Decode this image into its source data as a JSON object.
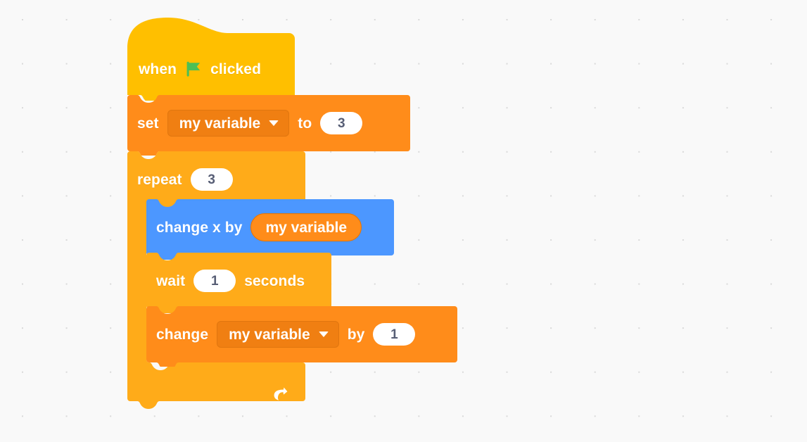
{
  "app": {
    "name": "Scratch Block Editor",
    "canvas_background": "#f9f9f9",
    "dot_color": "#d9d9d9"
  },
  "palette": {
    "events_yellow": "#ffbf00",
    "events_yellow_dark": "#e8a900",
    "variables_orange": "#ff8c1a",
    "variables_orange_dark": "#e77300",
    "variables_field": "#f07f12",
    "control_orange": "#ffab19",
    "control_orange_dark": "#e8950f",
    "motion_blue": "#4c97ff",
    "motion_blue_dark": "#3373cc",
    "field_white": "#ffffff",
    "field_text": "#575e75",
    "flag_green": "#4cbf56"
  },
  "script": {
    "blocks": [
      {
        "id": "when-flag-clicked",
        "category": "events",
        "word_before": "when",
        "icon": "green-flag-icon",
        "word_after": "clicked"
      },
      {
        "id": "set-variable-to",
        "category": "variables",
        "word_before": "set",
        "variable": "my variable",
        "word_middle": "to",
        "value": "3"
      },
      {
        "id": "repeat",
        "category": "control",
        "word_before": "repeat",
        "times": "3",
        "loop_icon": "loop-arrow-icon",
        "children": [
          {
            "id": "change-x-by",
            "category": "motion",
            "word_before": "change x by",
            "reporter": "my variable"
          },
          {
            "id": "wait-seconds",
            "category": "control",
            "word_before": "wait",
            "value": "1",
            "word_after": "seconds"
          },
          {
            "id": "change-variable-by",
            "category": "variables",
            "word_before": "change",
            "variable": "my variable",
            "word_middle": "by",
            "value": "1"
          }
        ]
      }
    ]
  }
}
